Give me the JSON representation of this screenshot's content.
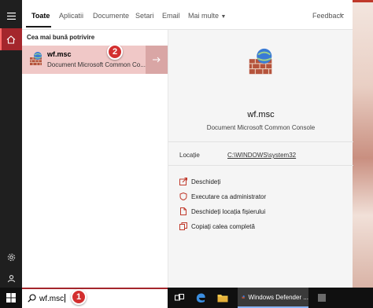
{
  "tabs": {
    "all": "Toate",
    "apps": "Aplicatii",
    "documents": "Documente",
    "settings": "Setari",
    "email": "Email",
    "more": "Mai multe",
    "feedback": "Feedback",
    "overflow": "···"
  },
  "best_match": {
    "section_label": "Cea mai bună potrivire",
    "name": "wf.msc",
    "subtitle": "Document Microsoft Common Co..."
  },
  "detail": {
    "title": "wf.msc",
    "subtitle": "Document Microsoft Common Console",
    "location_label": "Locație",
    "location_value": "C:\\WINDOWS\\system32",
    "actions": [
      "Deschideți",
      "Executare ca administrator",
      "Deschideți locația fișierului",
      "Copiați calea completă"
    ]
  },
  "search": {
    "query": "wf.msc"
  },
  "taskbar": {
    "app_label": "Windows Defender ..."
  },
  "annotations": {
    "step1": "1",
    "step2": "2"
  },
  "colors": {
    "accent": "#a4262c",
    "selected_row": "#f0c8c7",
    "badge": "#d32f2f"
  }
}
